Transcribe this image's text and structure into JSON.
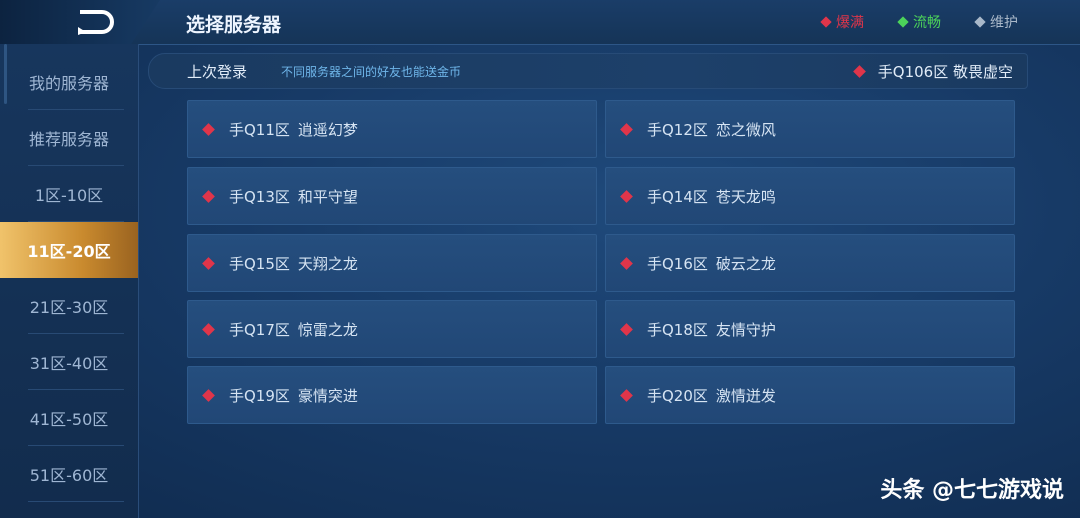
{
  "header": {
    "title": "选择服务器",
    "legend": [
      {
        "label": "爆满",
        "color": "#e0354a"
      },
      {
        "label": "流畅",
        "color": "#4cd35a"
      },
      {
        "label": "维护",
        "color": "#a9b8c9"
      }
    ]
  },
  "sidebar": {
    "items": [
      {
        "label": "我的服务器",
        "active": false
      },
      {
        "label": "推荐服务器",
        "active": false
      },
      {
        "label": "1区-10区",
        "active": false
      },
      {
        "label": "11区-20区",
        "active": true
      },
      {
        "label": "21区-30区",
        "active": false
      },
      {
        "label": "31区-40区",
        "active": false
      },
      {
        "label": "41区-50区",
        "active": false
      },
      {
        "label": "51区-60区",
        "active": false
      }
    ]
  },
  "last_login": {
    "label": "上次登录",
    "note": "不同服务器之间的好友也能送金币",
    "server": "手Q106区 敬畏虚空"
  },
  "servers": [
    {
      "code": "手Q11区",
      "name": "逍遥幻梦"
    },
    {
      "code": "手Q12区",
      "name": "恋之微风"
    },
    {
      "code": "手Q13区",
      "name": "和平守望"
    },
    {
      "code": "手Q14区",
      "name": "苍天龙鸣"
    },
    {
      "code": "手Q15区",
      "name": "天翔之龙"
    },
    {
      "code": "手Q16区",
      "name": "破云之龙"
    },
    {
      "code": "手Q17区",
      "name": "惊雷之龙"
    },
    {
      "code": "手Q18区",
      "name": "友情守护"
    },
    {
      "code": "手Q19区",
      "name": "豪情突进"
    },
    {
      "code": "手Q20区",
      "name": "激情迸发"
    }
  ],
  "watermark": "头条 @七七游戏说"
}
